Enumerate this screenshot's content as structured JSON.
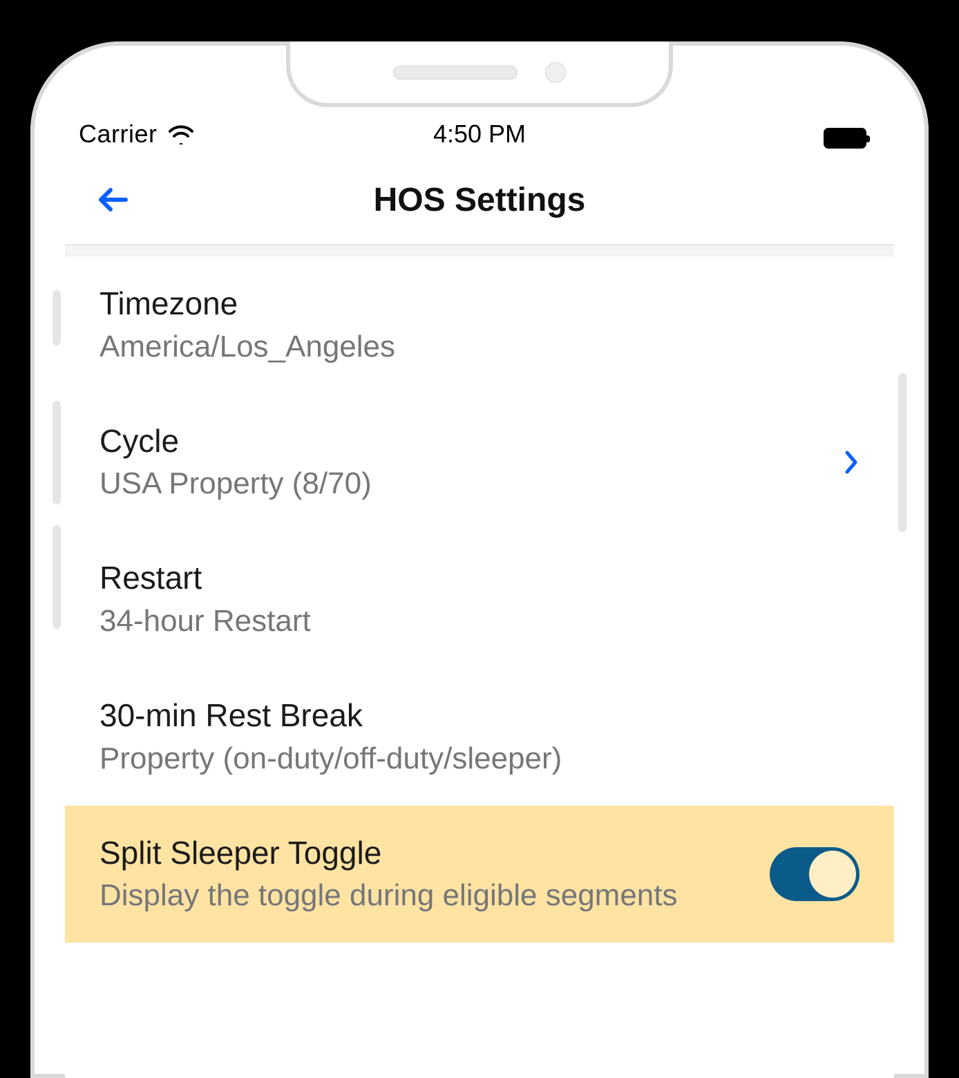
{
  "status_bar": {
    "carrier": "Carrier",
    "time": "4:50 PM"
  },
  "header": {
    "title": "HOS Settings"
  },
  "settings": {
    "timezone": {
      "label": "Timezone",
      "value": "America/Los_Angeles"
    },
    "cycle": {
      "label": "Cycle",
      "value": "USA Property (8/70)"
    },
    "restart": {
      "label": "Restart",
      "value": "34-hour Restart"
    },
    "rest_break": {
      "label": "30-min Rest Break",
      "value": "Property (on-duty/off-duty/sleeper)"
    },
    "split_sleeper": {
      "label": "Split Sleeper Toggle",
      "description": "Display the toggle during eligible segments",
      "enabled": true
    }
  },
  "colors": {
    "accent_blue": "#0a60ff",
    "toggle_track": "#0b5b8a",
    "highlight_bg": "#FEE3A3"
  }
}
